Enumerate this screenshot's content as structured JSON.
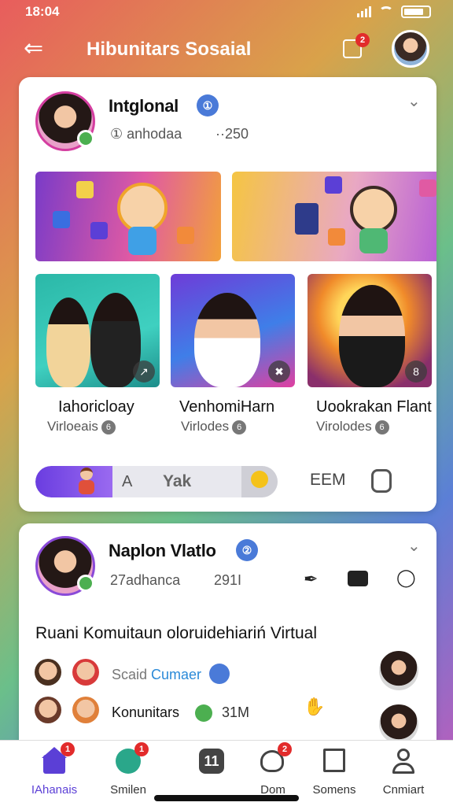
{
  "status": {
    "time": "18:04"
  },
  "header": {
    "title": "Hibunitars Sosaial",
    "notif_badge": "2"
  },
  "post1": {
    "name": "Intglonal",
    "handle": "① anhodaa",
    "count": "··250",
    "verified_icon": "①",
    "tiles": [
      {
        "title": "Iahoricloay",
        "sub": "Virloeais",
        "corner_icon": "↗",
        "sub_icon": "6"
      },
      {
        "title": "VenhomiHarn",
        "sub": "Virlodes",
        "corner_icon": "✖",
        "sub_icon": "6"
      },
      {
        "title": "Uookrakan Flant",
        "sub": "Virolodes",
        "corner_icon": "8",
        "sub_icon": "6"
      }
    ],
    "action": {
      "label1": "A",
      "label2": "Yak",
      "em": "EEM"
    }
  },
  "post2": {
    "name": "Naplon Vlatlo",
    "handle": "27adhanca",
    "count": "291I",
    "verified_icon": "②",
    "title": "Ruani Komuitaun oloruidehiariń Virtual",
    "row1_prefix": "Scaid",
    "row1_link": "Cumaer",
    "row2_label": "Konunitars",
    "row2_count": "31M"
  },
  "nav": [
    {
      "label": "IAhanais",
      "badge": "1"
    },
    {
      "label": "Smilen",
      "badge": "1"
    },
    {
      "label": ""
    },
    {
      "label": "Dom",
      "badge": "2"
    },
    {
      "label": "Somens"
    },
    {
      "label": "Cnmiart"
    }
  ],
  "colors": {
    "accent": "#5b3fd6",
    "badge": "#e22b2b",
    "verified": "#4a7ad8",
    "link": "#2b8ad8"
  }
}
